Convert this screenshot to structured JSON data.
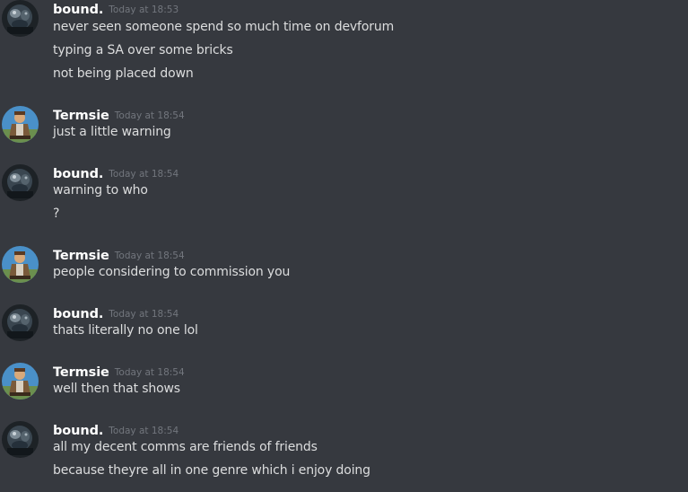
{
  "messages": [
    {
      "author": "bound.",
      "avatar_icon": "dark-robot-avatar-icon",
      "timestamp": "Today at 18:53",
      "lines": [
        "never seen someone spend so much time on devforum",
        "typing a SA over some bricks",
        "not being placed down"
      ]
    },
    {
      "author": "Termsie",
      "avatar_icon": "character-avatar-icon",
      "timestamp": "Today at 18:54",
      "lines": [
        "just a little warning"
      ]
    },
    {
      "author": "bound.",
      "avatar_icon": "dark-robot-avatar-icon",
      "timestamp": "Today at 18:54",
      "lines": [
        "warning to who",
        "?"
      ]
    },
    {
      "author": "Termsie",
      "avatar_icon": "character-avatar-icon",
      "timestamp": "Today at 18:54",
      "lines": [
        "people considering to commission you"
      ]
    },
    {
      "author": "bound.",
      "avatar_icon": "dark-robot-avatar-icon",
      "timestamp": "Today at 18:54",
      "lines": [
        "thats literally no one lol"
      ]
    },
    {
      "author": "Termsie",
      "avatar_icon": "character-avatar-icon",
      "timestamp": "Today at 18:54",
      "lines": [
        "well then that shows"
      ]
    },
    {
      "author": "bound.",
      "avatar_icon": "dark-robot-avatar-icon",
      "timestamp": "Today at 18:54",
      "lines": [
        "all my decent comms are friends of friends",
        "because theyre all in one genre which i enjoy doing"
      ]
    }
  ],
  "colors": {
    "background": "#36393f",
    "username": "#ffffff",
    "timestamp": "#72767d",
    "message_text": "#dcddde"
  }
}
